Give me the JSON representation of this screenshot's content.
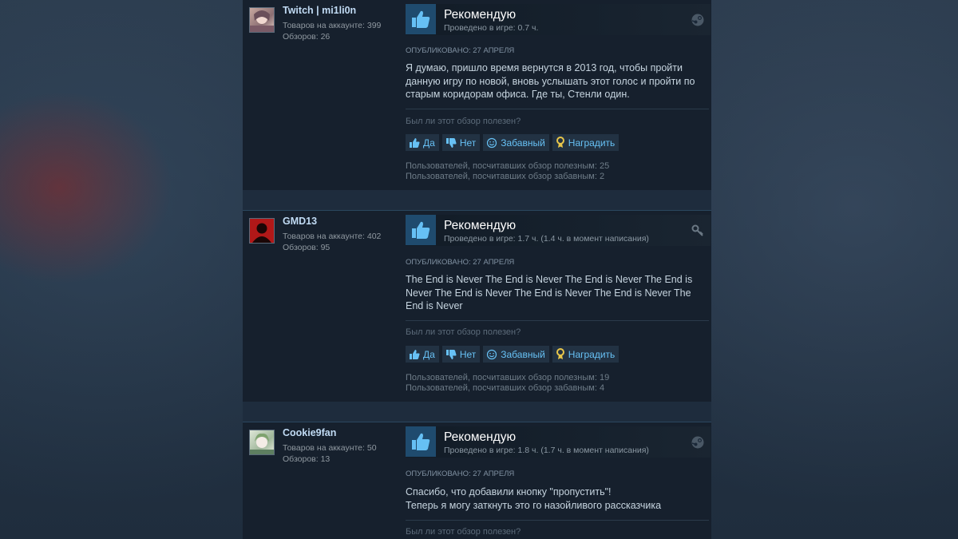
{
  "question_label": "Был ли этот обзор полезен?",
  "buttons": {
    "yes": "Да",
    "no": "Нет",
    "funny": "Забавный",
    "award": "Наградить"
  },
  "reviews": [
    {
      "author": "Twitch | mi1li0n",
      "products": "Товаров на аккаунте: 399",
      "reviews_count": "Обзоров: 26",
      "verdict": "Рекомендую",
      "playtime": "Проведено в игре: 0.7 ч.",
      "posted": "Опубликовано: 27 апреля",
      "text": "Я думаю, пришло время вернутся в 2013 год, чтобы пройти данную игру по новой, вновь услышать этот голос и пройти по старым коридорам офиса. Где ты, Стенли один.",
      "helpful_count": "Пользователей, посчитавших обзор полезным: 25",
      "funny_count": "Пользователей, посчитавших обзор забавным: 2",
      "badge_icon": "steam-icon"
    },
    {
      "author": "GMD13",
      "products": "Товаров на аккаунте: 402",
      "reviews_count": "Обзоров: 95",
      "verdict": "Рекомендую",
      "playtime": "Проведено в игре: 1.7 ч. (1.4 ч. в момент написания)",
      "posted": "Опубликовано: 27 апреля",
      "text": "The End is Never The End is Never The End is Never The End is Never The End is Never The End is Never The End is Never The End is Never",
      "helpful_count": "Пользователей, посчитавших обзор полезным: 19",
      "funny_count": "Пользователей, посчитавших обзор забавным: 4",
      "badge_icon": "key-icon"
    },
    {
      "author": "Cookie9fan",
      "products": "Товаров на аккаунте: 50",
      "reviews_count": "Обзоров: 13",
      "verdict": "Рекомендую",
      "playtime": "Проведено в игре: 1.8 ч. (1.7 ч. в момент написания)",
      "posted": "Опубликовано: 27 апреля",
      "text_line1": "Спасибо, что добавили кнопку \"пропустить\"!",
      "text_line2": "Теперь я могу заткнуть это го назойливого рассказчика",
      "badge_icon": "steam-icon"
    }
  ]
}
